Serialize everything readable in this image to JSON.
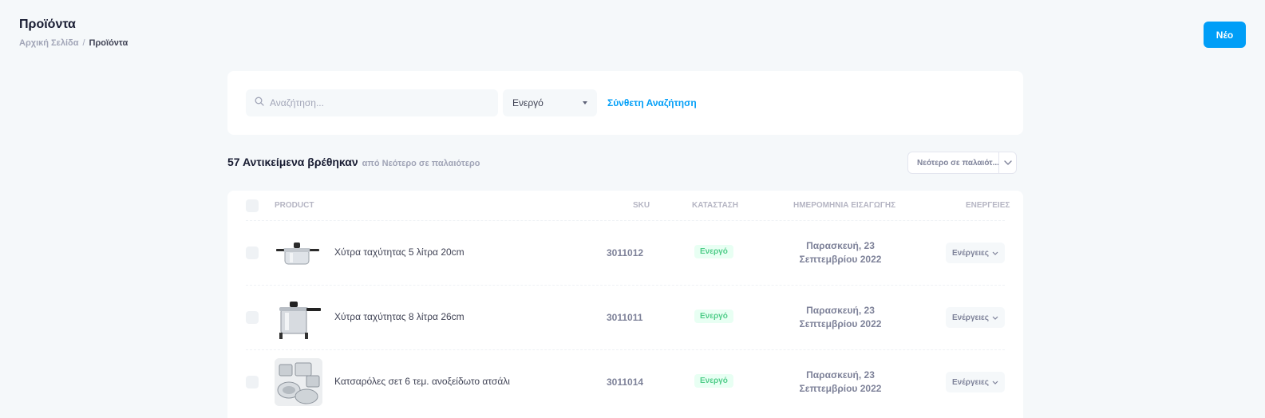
{
  "header": {
    "title": "Προϊόντα",
    "breadcrumb": {
      "home": "Αρχική Σελίδα",
      "separator": "/",
      "current": "Προϊόντα"
    },
    "new_button": "Νέο"
  },
  "filters": {
    "search_placeholder": "Αναζήτηση...",
    "status_value": "Ενεργό",
    "advanced_search": "Σύνθετη Αναζήτηση"
  },
  "results": {
    "count_text": "57 Αντικείμενα βρέθηκαν",
    "sort_label": "από Νεότερο σε παλαιότερο",
    "sort_select_value": "Νεότερο σε παλαιότ..."
  },
  "table": {
    "headers": {
      "product": "PRODUCT",
      "sku": "SKU",
      "status": "ΚΑΤΑΣΤΑΣΗ",
      "date": "ΗΜΕΡΟΜΗΝΙΑ ΕΙΣΑΓΩΓΗΣ",
      "actions": "ΕΝΕΡΓΕΙΕΣ"
    },
    "rows": [
      {
        "name": "Χύτρα ταχύτητας 5 λίτρα 20cm",
        "sku": "3011012",
        "status": "Ενεργό",
        "date_line1": "Παρασκευή, 23",
        "date_line2": "Σεπτεμβρίου 2022",
        "action": "Ενέργειες",
        "thumb": "pressure-cooker-small-image"
      },
      {
        "name": "Χύτρα ταχύτητας 8 λίτρα 26cm",
        "sku": "3011011",
        "status": "Ενεργό",
        "date_line1": "Παρασκευή, 23",
        "date_line2": "Σεπτεμβρίου 2022",
        "action": "Ενέργειες",
        "thumb": "pressure-cooker-large-image"
      },
      {
        "name": "Κατσαρόλες σετ 6 τεμ. ανοξείδωτο ατσάλι",
        "sku": "3011014",
        "status": "Ενεργό",
        "date_line1": "Παρασκευή, 23",
        "date_line2": "Σεπτεμβρίου 2022",
        "action": "Ενέργειες",
        "thumb": "cookware-set-image"
      }
    ]
  },
  "colors": {
    "primary": "#009ef7",
    "success_text": "#50cd89",
    "success_bg": "#e8fff3",
    "page_bg": "#f5f8fa"
  }
}
